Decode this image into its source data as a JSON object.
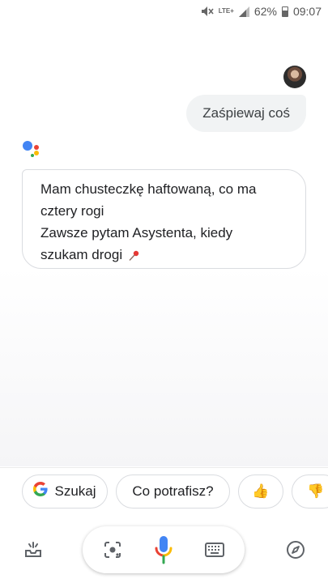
{
  "status_bar": {
    "network_label": "LTE+",
    "battery_percent": "62%",
    "battery_level": 0.62,
    "time": "09:07",
    "icons": [
      "mute-icon",
      "lte-icon",
      "signal-icon",
      "battery-icon"
    ]
  },
  "chat": {
    "user_message": "Zaśpiewaj coś",
    "assistant_lines": [
      "Mam chusteczkę haftowaną, co ma",
      "cztery rogi",
      "Zawsze pytam Asystenta, kiedy",
      "szukam drogi"
    ],
    "assistant_emoji": "pushpin-icon"
  },
  "suggestions": {
    "search_label": "Szukaj",
    "ability_label": "Co potrafisz?",
    "thumbs_up": "👍",
    "thumbs_down": "👎"
  },
  "bottom_bar": {
    "icons": [
      "inbox-icon",
      "lens-icon",
      "mic-icon",
      "keyboard-icon",
      "compass-icon"
    ]
  },
  "colors": {
    "google_blue": "#4285f4",
    "google_red": "#ea4335",
    "google_yellow": "#fbbc05",
    "google_green": "#34a853"
  }
}
